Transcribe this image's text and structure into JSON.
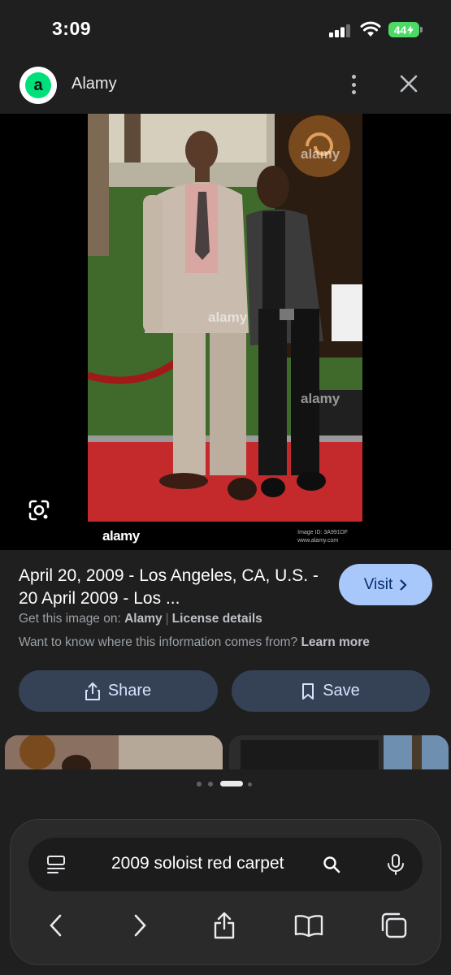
{
  "status_bar": {
    "time": "3:09",
    "battery": "44"
  },
  "header": {
    "site_name": "Alamy",
    "logo_letter": "a"
  },
  "image": {
    "watermark": "alamy",
    "footer_logo": "alamy",
    "image_id": "Image ID: 3A991DF",
    "site_url": "www.alamy.com"
  },
  "result": {
    "title": "April 20, 2009 - Los Angeles, CA, U.S. - 20 April 2009 - Los ...",
    "visit_label": "Visit",
    "get_image_prefix": "Get this image on:",
    "get_image_source": "Alamy",
    "license_label": "License details",
    "info_question": "Want to know where this information comes from?",
    "learn_more": "Learn more",
    "share_label": "Share",
    "save_label": "Save"
  },
  "pager": {
    "count": 4,
    "active": 2
  },
  "browser": {
    "query": "2009 soloist red carpet"
  }
}
